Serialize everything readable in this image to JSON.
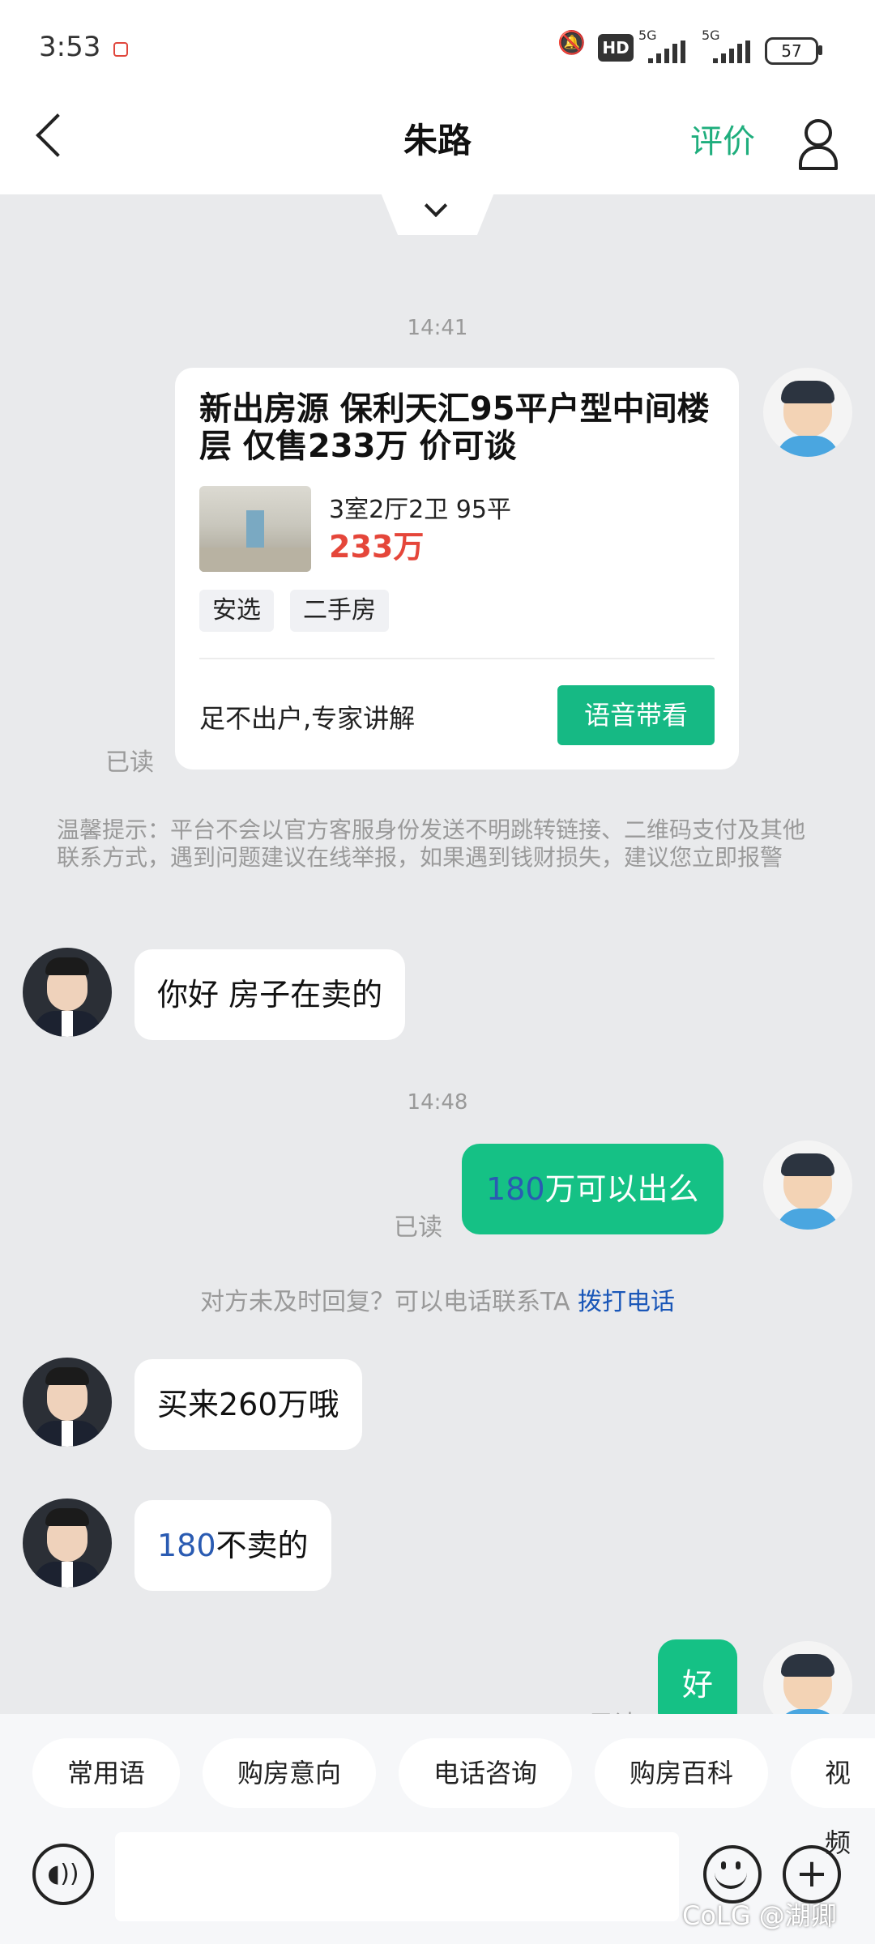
{
  "status_bar": {
    "time": "3:53",
    "network1": "5G",
    "network2": "5G",
    "hd": "HD",
    "battery": "57",
    "icons": [
      "mute-icon",
      "record-icon",
      "signal-icon",
      "battery-icon"
    ]
  },
  "header": {
    "title": "朱路",
    "rate_label": "评价"
  },
  "messages": {
    "t1": "14:41",
    "card": {
      "title": "新出房源 保利天汇95平户型中间楼层 仅售233万 价可谈",
      "layout": "3室2厅2卫 95平",
      "price": "233万",
      "tags": [
        "安选",
        "二手房"
      ],
      "footer_text": "足不出户,专家讲解",
      "button_label": "语音带看",
      "read": "已读"
    },
    "notice": "温馨提示：平台不会以官方客服身份发送不明跳转链接、二维码支付及其他联系方式，遇到问题建议在线举报，如果遇到钱财损失，建议您立即报警",
    "m1": "你好 房子在卖的",
    "t2": "14:48",
    "m2_num": "180",
    "m2_rest": "万可以出么",
    "m2_read": "已读",
    "call_hint": "对方未及时回复？可以电话联系TA ",
    "call_link": "拨打电话",
    "m3": "买来260万哦",
    "m4_num": "180",
    "m4_rest": "不卖的",
    "m5": "好",
    "m5_read": "已读"
  },
  "quick_replies": [
    "常用语",
    "购房意向",
    "电话咨询",
    "购房百科",
    "视频"
  ],
  "watermark": "CoLG @湖卿",
  "colors": {
    "accent": "#1fae7d",
    "bubble_out": "#15c185",
    "price": "#e5463a",
    "link": "#1a57b8"
  }
}
